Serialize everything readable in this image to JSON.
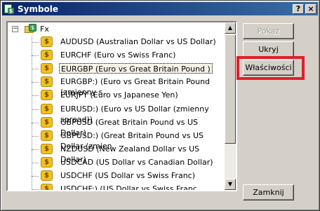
{
  "window": {
    "title": "Symbole",
    "help_button": "?",
    "close_button": "×"
  },
  "tree": {
    "root": {
      "label": "Fx",
      "expander": "−"
    },
    "symbols": [
      {
        "label": "AUDUSD  (Australian Dollar vs US Dollar)",
        "selected": false
      },
      {
        "label": "EURCHF  (Euro vs Swiss Franc)",
        "selected": false
      },
      {
        "label": "EURGBP  (Euro vs Great Britain Pound )",
        "selected": true
      },
      {
        "label": "EURGBP:)  (Euro vs Great Britain Pound  (zmienny s",
        "selected": false
      },
      {
        "label": "EURJPY  (Euro vs Japanese Yen)",
        "selected": false
      },
      {
        "label": "EURUSD:)  (Euro vs US Dollar (zmienny spread))",
        "selected": false
      },
      {
        "label": "GBPUSD  (Great Britain Pound vs US Dollar)",
        "selected": false
      },
      {
        "label": "GBPUSD:)  (Great Britain Pound vs US Dollar (zmien",
        "selected": false
      },
      {
        "label": "NZDUSD  (New Zealand Dollar vs US Dollar)",
        "selected": false
      },
      {
        "label": "USDCAD  (US Dollar vs Canadian Dollar)",
        "selected": false
      },
      {
        "label": "USDCHF  (US Dollar vs Swiss Franc)",
        "selected": false
      },
      {
        "label": "USDCHF:)  (US Dollar vs Swiss Franc (zmienny spre",
        "selected": false
      }
    ],
    "symbol_icon_glyph": "$",
    "scroll_up_glyph": "▲",
    "scroll_down_glyph": "▼"
  },
  "buttons": {
    "show": {
      "label": "Pokaż",
      "enabled": false
    },
    "hide": {
      "label": "Ukryj",
      "enabled": true
    },
    "properties": {
      "label": "Właściwości",
      "enabled": true,
      "highlighted": true
    },
    "close": {
      "label": "Zamknij",
      "enabled": true
    }
  },
  "colors": {
    "highlight_border": "#e0202a",
    "symbol_icon": "#f2c21c",
    "titlebar_start": "#0a246a",
    "titlebar_end": "#3a6ea5"
  }
}
